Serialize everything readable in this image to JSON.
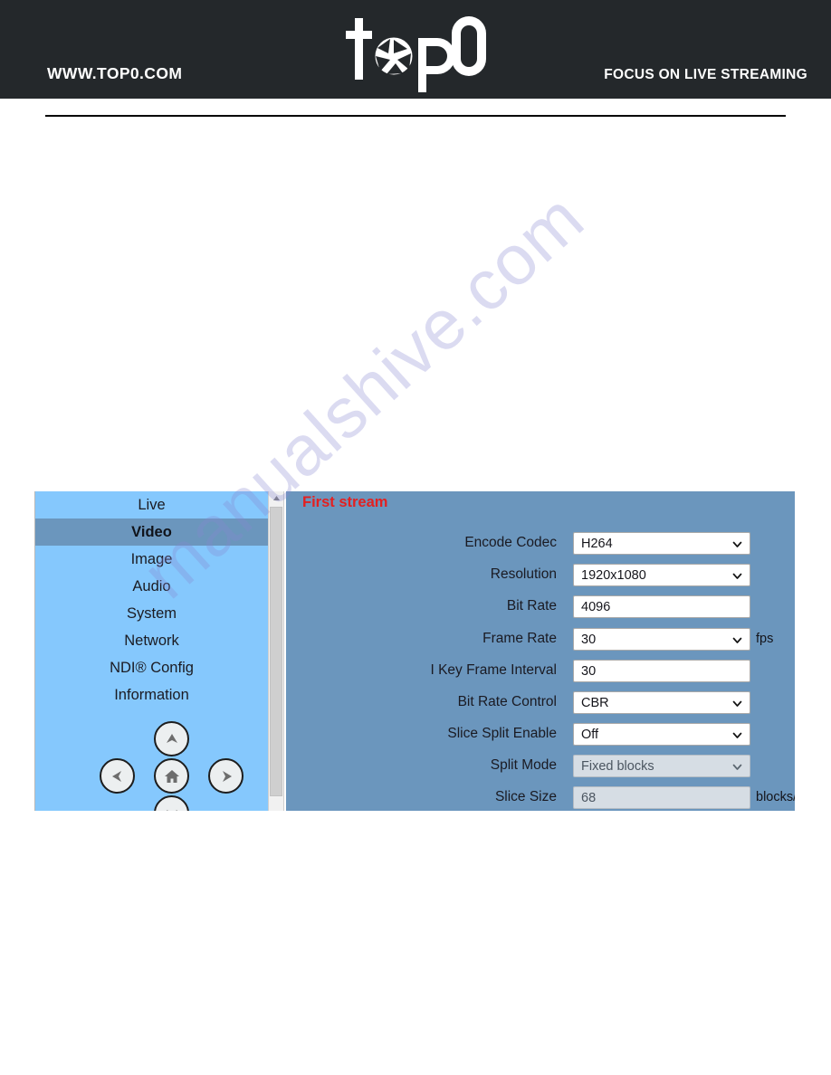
{
  "header": {
    "url": "WWW.TOP0.COM",
    "tagline": "FOCUS ON LIVE STREAMING",
    "logo_text": "top0",
    "logo_icon": "camera-aperture-icon"
  },
  "watermark": {
    "text": "manualshive.com"
  },
  "colors": {
    "header_bg": "#24282b",
    "sidebar_bg": "#85c8fd",
    "panel_bg": "#6b96bd",
    "selected_nav_bg": "#6b96bd",
    "title_red": "#e32020",
    "input_bg": "#ffffff",
    "input_disabled_bg": "#d6dde4"
  },
  "sidebar": {
    "items": [
      {
        "label": "Live",
        "selected": false
      },
      {
        "label": "Video",
        "selected": true
      },
      {
        "label": "Image",
        "selected": false
      },
      {
        "label": "Audio",
        "selected": false
      },
      {
        "label": "System",
        "selected": false
      },
      {
        "label": "Network",
        "selected": false
      },
      {
        "label": "NDI® Config",
        "selected": false
      },
      {
        "label": "Information",
        "selected": false
      }
    ],
    "dpad": {
      "up_icon": "arrow-up-icon",
      "left_icon": "arrow-left-icon",
      "home_icon": "home-icon",
      "right_icon": "arrow-right-icon",
      "down_icon": "arrow-down-icon"
    },
    "scrollbar": {
      "up_arrow_icon": "scroll-up-arrow-icon"
    }
  },
  "panel": {
    "title": "First stream",
    "rows": [
      {
        "label": "Encode Codec",
        "value": "H264",
        "control": "select",
        "disabled": false,
        "unit": ""
      },
      {
        "label": "Resolution",
        "value": "1920x1080",
        "control": "select",
        "disabled": false,
        "unit": ""
      },
      {
        "label": "Bit Rate",
        "value": "4096",
        "control": "text",
        "disabled": false,
        "unit": ""
      },
      {
        "label": "Frame Rate",
        "value": "30",
        "control": "select",
        "disabled": false,
        "unit": "fps"
      },
      {
        "label": "I Key Frame Interval",
        "value": "30",
        "control": "text",
        "disabled": false,
        "unit": ""
      },
      {
        "label": "Bit Rate Control",
        "value": "CBR",
        "control": "select",
        "disabled": false,
        "unit": ""
      },
      {
        "label": "Slice Split Enable",
        "value": "Off",
        "control": "select",
        "disabled": false,
        "unit": ""
      },
      {
        "label": "Split Mode",
        "value": "Fixed blocks",
        "control": "select",
        "disabled": true,
        "unit": ""
      },
      {
        "label": "Slice Size",
        "value": "68",
        "control": "text",
        "disabled": true,
        "unit": "blocks/bytes"
      }
    ]
  }
}
